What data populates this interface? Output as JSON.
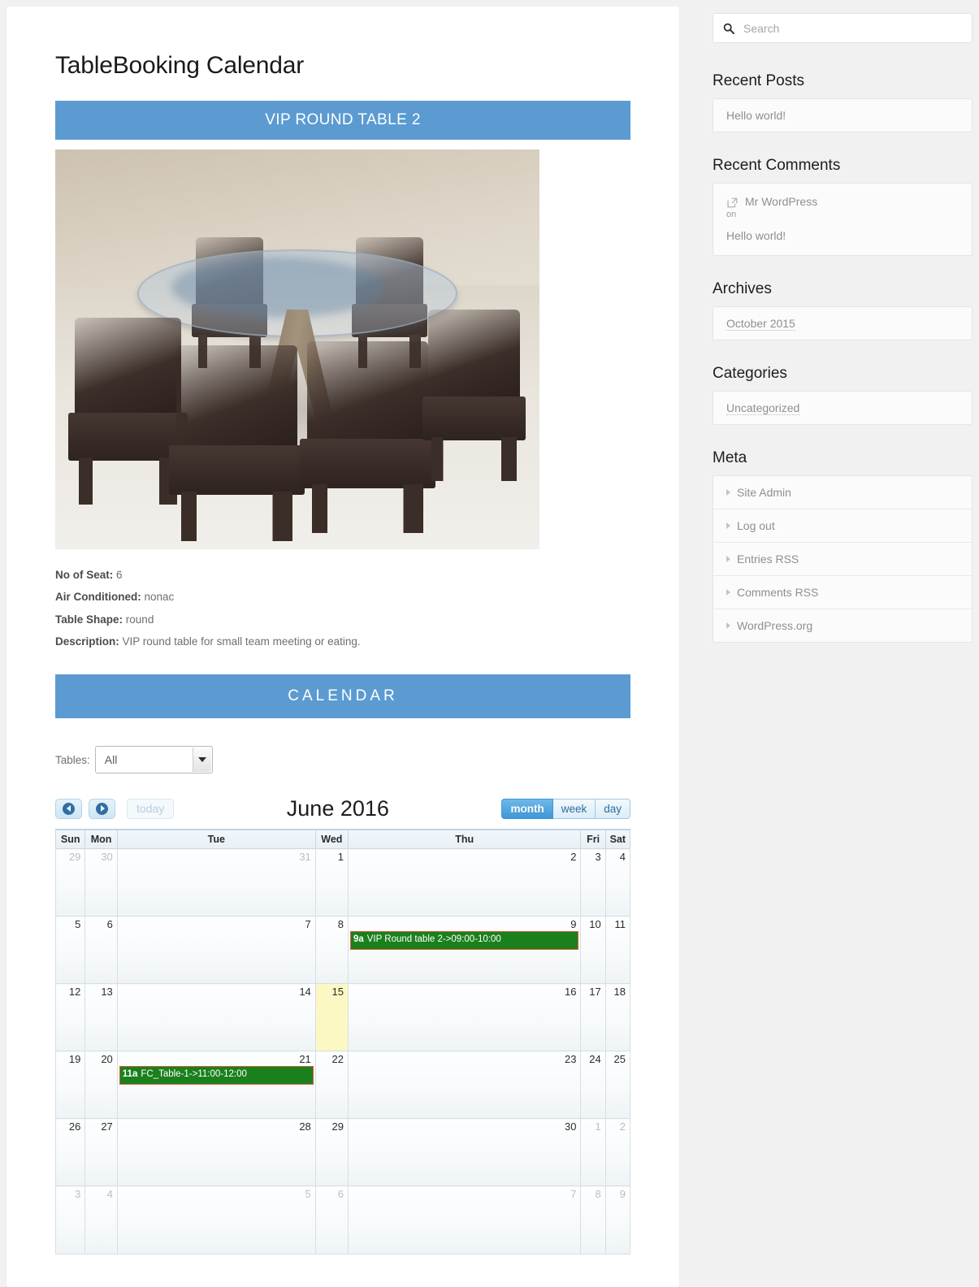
{
  "main": {
    "page_title": "TableBooking Calendar",
    "table_band": "VIP ROUND TABLE 2",
    "calendar_band": "CALENDAR",
    "details": [
      {
        "label": "No of Seat:",
        "value": "6"
      },
      {
        "label": "Air Conditioned:",
        "value": "nonac"
      },
      {
        "label": "Table Shape:",
        "value": "round"
      },
      {
        "label": "Description:",
        "value": "VIP round table for small team meeting or eating."
      }
    ],
    "tables_filter": {
      "label": "Tables:",
      "selected": "All",
      "options": [
        "All"
      ]
    }
  },
  "calendar": {
    "title": "June 2016",
    "prev_label": "prev",
    "next_label": "next",
    "today_label": "today",
    "views": [
      {
        "label": "month",
        "active": true
      },
      {
        "label": "week",
        "active": false
      },
      {
        "label": "day",
        "active": false
      }
    ],
    "weekdays": [
      "Sun",
      "Mon",
      "Tue",
      "Wed",
      "Thu",
      "Fri",
      "Sat"
    ],
    "today_date": "15",
    "event_bg": "#1a801c",
    "event_border": "#d4603a",
    "today_bg": "#fcf8c3",
    "accent": "#5b9bd1",
    "weeks": [
      [
        {
          "day": "29",
          "other": true
        },
        {
          "day": "30",
          "other": true
        },
        {
          "day": "31",
          "other": true
        },
        {
          "day": "1",
          "other": false
        },
        {
          "day": "2",
          "other": false
        },
        {
          "day": "3",
          "other": false
        },
        {
          "day": "4",
          "other": false
        }
      ],
      [
        {
          "day": "5",
          "other": false
        },
        {
          "day": "6",
          "other": false
        },
        {
          "day": "7",
          "other": false
        },
        {
          "day": "8",
          "other": false
        },
        {
          "day": "9",
          "other": false,
          "event": {
            "time": "9a",
            "body": "VIP Round table 2->09:00-10:00"
          }
        },
        {
          "day": "10",
          "other": false
        },
        {
          "day": "11",
          "other": false
        }
      ],
      [
        {
          "day": "12",
          "other": false
        },
        {
          "day": "13",
          "other": false
        },
        {
          "day": "14",
          "other": false
        },
        {
          "day": "15",
          "other": false,
          "today": true
        },
        {
          "day": "16",
          "other": false
        },
        {
          "day": "17",
          "other": false
        },
        {
          "day": "18",
          "other": false
        }
      ],
      [
        {
          "day": "19",
          "other": false
        },
        {
          "day": "20",
          "other": false
        },
        {
          "day": "21",
          "other": false,
          "event": {
            "time": "11a",
            "body": "FC_Table-1->11:00-12:00"
          }
        },
        {
          "day": "22",
          "other": false
        },
        {
          "day": "23",
          "other": false
        },
        {
          "day": "24",
          "other": false
        },
        {
          "day": "25",
          "other": false
        }
      ],
      [
        {
          "day": "26",
          "other": false
        },
        {
          "day": "27",
          "other": false
        },
        {
          "day": "28",
          "other": false
        },
        {
          "day": "29",
          "other": false
        },
        {
          "day": "30",
          "other": false
        },
        {
          "day": "1",
          "other": true
        },
        {
          "day": "2",
          "other": true
        }
      ],
      [
        {
          "day": "3",
          "other": true
        },
        {
          "day": "4",
          "other": true
        },
        {
          "day": "5",
          "other": true
        },
        {
          "day": "6",
          "other": true
        },
        {
          "day": "7",
          "other": true
        },
        {
          "day": "8",
          "other": true
        },
        {
          "day": "9",
          "other": true
        }
      ]
    ]
  },
  "sidebar": {
    "search": {
      "placeholder": "Search",
      "value": "",
      "icon": "search-icon"
    },
    "recent_posts": {
      "title": "Recent Posts",
      "items": [
        "Hello world!"
      ]
    },
    "recent_comments": {
      "title": "Recent Comments",
      "author": "Mr WordPress",
      "on": "on",
      "post": "Hello world!",
      "icon": "external-link-icon"
    },
    "archives": {
      "title": "Archives",
      "items": [
        "October 2015"
      ]
    },
    "categories": {
      "title": "Categories",
      "items": [
        "Uncategorized"
      ]
    },
    "meta": {
      "title": "Meta",
      "items": [
        "Site Admin",
        "Log out",
        "Entries RSS",
        "Comments RSS",
        "WordPress.org"
      ]
    }
  }
}
